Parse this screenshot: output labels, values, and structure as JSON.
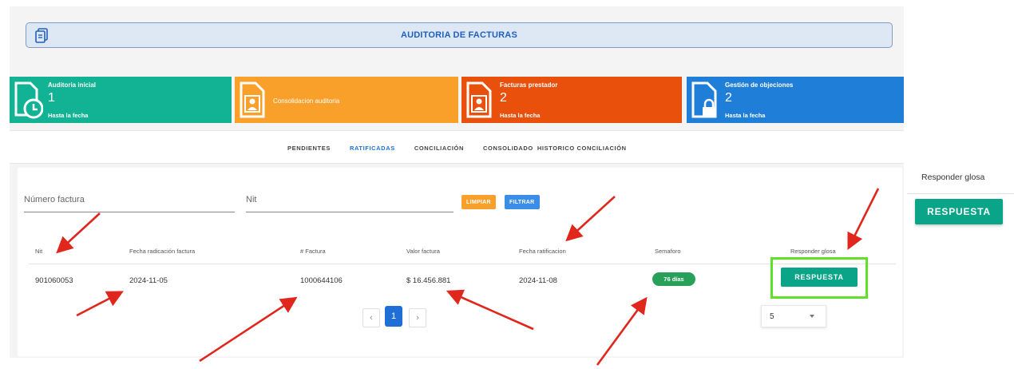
{
  "header": {
    "title": "AUDITORIA DE FACTURAS",
    "icon": "document-copy-icon"
  },
  "cards": [
    {
      "title": "Auditoria inicial",
      "count": "1",
      "subtitle": "Hasta la fecha",
      "color": "#12b294",
      "icon": "document-clock-icon"
    },
    {
      "title": "",
      "label": "Consolidacion auditoria",
      "count": "",
      "subtitle": "",
      "color": "#f9a02b",
      "icon": "document-person-icon"
    },
    {
      "title": "Facturas prestador",
      "count": "2",
      "subtitle": "Hasta la fecha",
      "color": "#e8500c",
      "icon": "document-person-icon"
    },
    {
      "title": "Gestión de objeciones",
      "count": "2",
      "subtitle": "Hasta la fecha",
      "color": "#1f7ed8",
      "icon": "document-lock-icon"
    }
  ],
  "tabs": [
    {
      "label": "PENDIENTES",
      "active": false
    },
    {
      "label": "RATIFICADAS",
      "active": true
    },
    {
      "label": "CONCILIACIÓN",
      "active": false
    },
    {
      "label": "CONSOLIDADO",
      "active": false
    },
    {
      "label": "HISTORICO CONCILIACIÓN",
      "active": false
    }
  ],
  "filters": {
    "invoice_placeholder": "Número factura",
    "nit_placeholder": "Nit",
    "clear_label": "LIMPIAR",
    "filter_label": "FILTRAR"
  },
  "table": {
    "headers": [
      "Nit",
      "Fecha radicación factura",
      "# Factura",
      "Valor factura",
      "Fecha ratificacion",
      "Semaforo",
      "Responder glosa"
    ],
    "rows": [
      {
        "nit": "901060053",
        "fecha_radicacion": "2024-11-05",
        "factura": "1000644106",
        "valor": "$ 16.456.881",
        "fecha_ratificacion": "2024-11-08",
        "semaforo": "76 días",
        "action": "RESPUESTA"
      }
    ]
  },
  "pagination": {
    "prev": "‹",
    "current": "1",
    "next": "›",
    "page_size": "5"
  },
  "side_panel": {
    "label": "Responder glosa",
    "button": "RESPUESTA"
  },
  "colors": {
    "teal": "#0aa589",
    "orange": "#f9a02b",
    "blue": "#1f6fd6",
    "badge_green": "#27a05a",
    "highlight": "#5fe02a",
    "arrow": "#e0261d"
  }
}
